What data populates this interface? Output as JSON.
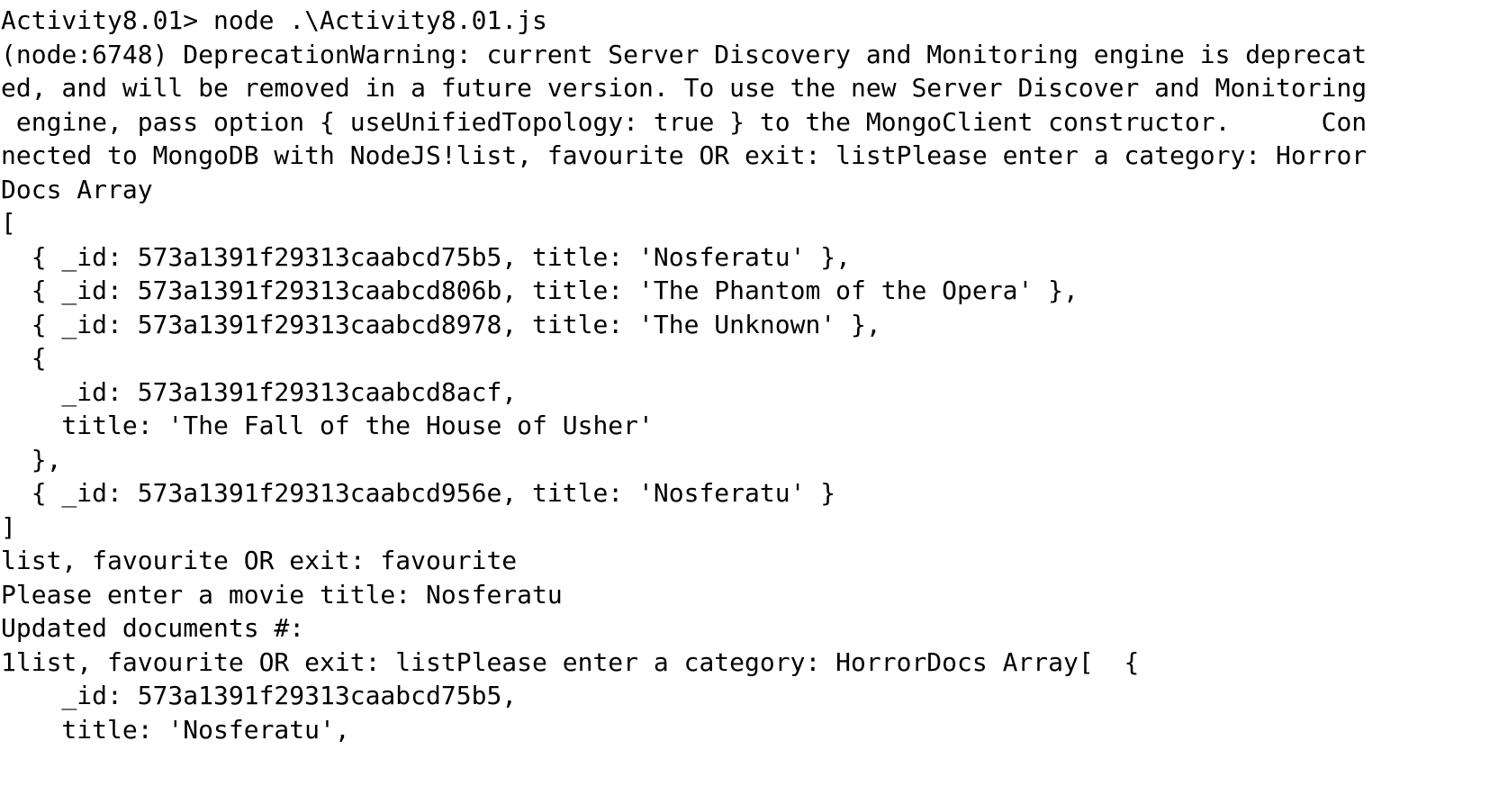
{
  "terminal": {
    "lines": [
      "Activity8.01> node .\\Activity8.01.js",
      "(node:6748) DeprecationWarning: current Server Discovery and Monitoring engine is deprecat",
      "ed, and will be removed in a future version. To use the new Server Discover and Monitoring",
      " engine, pass option { useUnifiedTopology: true } to the MongoClient constructor.      Con",
      "nected to MongoDB with NodeJS!list, favourite OR exit: listPlease enter a category: Horror",
      "Docs Array",
      "[",
      "  { _id: 573a1391f29313caabcd75b5, title: 'Nosferatu' },",
      "  { _id: 573a1391f29313caabcd806b, title: 'The Phantom of the Opera' },",
      "  { _id: 573a1391f29313caabcd8978, title: 'The Unknown' },",
      "  {",
      "    _id: 573a1391f29313caabcd8acf,",
      "    title: 'The Fall of the House of Usher'",
      "  },",
      "  { _id: 573a1391f29313caabcd956e, title: 'Nosferatu' }",
      "]",
      "list, favourite OR exit: favourite",
      "Please enter a movie title: Nosferatu",
      "Updated documents #:",
      "1list, favourite OR exit: listPlease enter a category: HorrorDocs Array[  {",
      "    _id: 573a1391f29313caabcd75b5,",
      "    title: 'Nosferatu',"
    ]
  }
}
